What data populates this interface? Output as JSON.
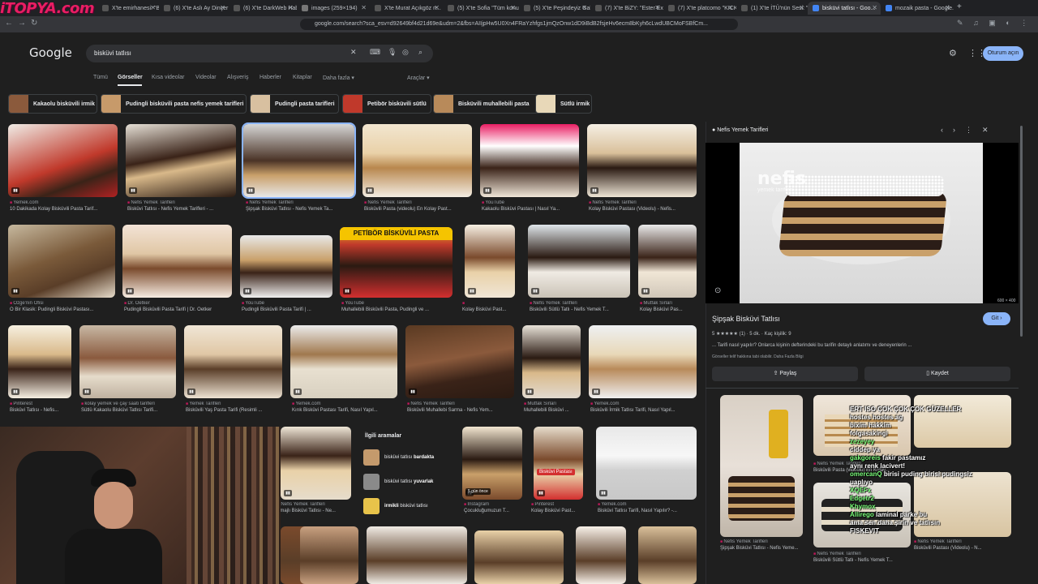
{
  "overlay_logo": "iTOPYA.com",
  "tabs": [
    {
      "label": "X'te emirhanesi: \"Bob..."
    },
    {
      "label": "(6) X'te Aslı Ay Dinçer: \"..."
    },
    {
      "label": "(6) X'te DarkWeb Haber..."
    },
    {
      "label": "images (259×194)"
    },
    {
      "label": "X'te Murat Açıkgöz n..."
    },
    {
      "label": "(5) X'te Sofia \"Tüm konu..."
    },
    {
      "label": "(5) X'te Peşindeyiz Galati..."
    },
    {
      "label": "(7) X'te BiZY: \"Ester Expo"
    },
    {
      "label": "(7) X'te platcomo \"KICK..."
    },
    {
      "label": "(1) X'te İTÜ'nün Sesi: \"K..."
    },
    {
      "label": "bisküvi tatlısı - Goo..."
    },
    {
      "label": "mozaik pasta - Google..."
    }
  ],
  "address": "google.com/search?sca_esv=d92649bf4d21d69e&udm=2&fbs=AIIjpHw5U0Xn4FRaYzhfgs1jmQzOnw1dD9iBdB2fsjeHv6ecm8bKyh6cLwdUBCMoFSBfCm...",
  "google_logo": "Google",
  "search": {
    "query": "bisküvi tatlısı"
  },
  "signin_label": "Oturum açın",
  "nav_tabs": [
    "Tümü",
    "Görseller",
    "Kısa videolar",
    "Videolar",
    "Alışveriş",
    "Haberler",
    "Kitaplar",
    "Daha fazla ▾"
  ],
  "tools_label": "Araçlar ▾",
  "chips": [
    "Kakaolu bisküvili irmik",
    "Pudingli bisküvili pasta nefis yemek tarifleri",
    "Pudingli pasta tarifleri",
    "Petibör bisküvili sütlü",
    "Bisküvili muhallebili pasta",
    "Sütlü irmik"
  ],
  "results": [
    {
      "src": "Yemek.com",
      "title": "10 Dakikada Kolay Bisküvili Pasta Tarif..."
    },
    {
      "src": "Nefis Yemek Tarifleri",
      "title": "Bisküvi Tatlısı - Nefis Yemek Tarifleri - ..."
    },
    {
      "src": "Nefis Yemek Tarifleri",
      "title": "Şipşak Bisküvi Tatlısı - Nefis Yemek Ta..."
    },
    {
      "src": "Nefis Yemek Tarifleri",
      "title": "Bisküvili Pasta (videolu) En Kolay Past..."
    },
    {
      "src": "YouTube",
      "title": "Kakaolu Bisküvi Pastası | Nasıl Ya..."
    },
    {
      "src": "Nefis Yemek Tarifleri",
      "title": "Kolay Bisküvi Pastası (Videolu) - Nefis..."
    },
    {
      "src": "Özge'nin Ofisi",
      "title": "O Bir Klasik: Pudingli Bisküvi Pastası..."
    },
    {
      "src": "Dr. Oetker",
      "title": "Pudingli Bisküvili Pasta Tarifi | Dr. Oetker"
    },
    {
      "src": "YouTube",
      "title": "Pudingli Bisküvili Pasta Tarifi | ..."
    },
    {
      "src": "YouTube",
      "title": "Muhallebili Bisküvili Pasta, Pudingli ve ..."
    },
    {
      "src": "",
      "title": "Kolay Bisküvi Past..."
    },
    {
      "src": "Nefis Yemek Tarifleri",
      "title": "Bisküvili Sütlü Tatlı - Nefis Yemek T..."
    },
    {
      "src": "Mutfak Sırları",
      "title": "Kolay Bisküvi Pas..."
    },
    {
      "src": "Pinterest",
      "title": "Bisküvi Tatlısı - Nefis..."
    },
    {
      "src": "kolay yemek ve çay saati tarifleri",
      "title": "Sütlü Kakaolu Bisküvi Tatlısı Tarifi..."
    },
    {
      "src": "Yemek Tarifleri",
      "title": "Bisküvili Yaş Pasta Tarifi (Resimli ..."
    },
    {
      "src": "Yemek.com",
      "title": "Kırık Bisküvi Pastası Tarifi, Nasıl Yapıl..."
    },
    {
      "src": "Nefis Yemek Tarifleri",
      "title": "Bisküvili Muhallebi Sarma - Nefis Yem..."
    },
    {
      "src": "Mutfak Sırları",
      "title": "Muhallebili Bisküvi ..."
    },
    {
      "src": "Yemek.com",
      "title": "Bisküvili İrmik Tatlısı Tarifi, Nasıl Yapıl..."
    },
    {
      "src": "Nefis Yemek Tarifleri",
      "title": "amajlı Bisküvi Tatlısı - Ne..."
    },
    {
      "src": "Instagram",
      "title": "Çocukluğumuzun T..."
    },
    {
      "src": "Pinterest",
      "title": "Kolay Bisküvi Past..."
    },
    {
      "src": "Yemek.com",
      "title": "Bisküvi Tatlısı Tarifi, Nasıl Yapılır? -..."
    }
  ],
  "badges": {
    "video_ago": "5 gün önce",
    "petibor_banner": "PETİBÖR BİSKÜVİLİ PASTA",
    "biskuvi_pastasi": "Bisküvi Pastası"
  },
  "related": {
    "title": "İlgili aramalar",
    "items": [
      {
        "pre": "bisküvi tatlısı ",
        "bold": "bardakta"
      },
      {
        "pre": "bisküvi tatlısı ",
        "bold": "yuvarlak"
      },
      {
        "pre": "",
        "bold": "irmikli",
        "post": " bisküvi tatlısı"
      }
    ]
  },
  "panel": {
    "source": "Nefis Yemek Tarifleri",
    "watermark": "nefis",
    "watermark_sub": "yemek tarifleri",
    "dims": "600 × 400",
    "title": "Şipşak Bisküvi Tatlısı",
    "go_label": "Git ›",
    "rating": "5 ★★★★★ (1)  ·  5 dk.  ·  Kaç kişilik: 9",
    "description": "... Tarifi nasıl yapılır? Onlarca kişinin defterindeki bu tarifin detaylı anlatımı ve deneyenlerin ...",
    "copyright": "Görseller telif hakkına tabi olabilir. Daha Fazla Bilgi",
    "share_label": "Paylaş",
    "save_label": "Kaydet",
    "related_captions": [
      {
        "src": "Nefis Yemek Tarifleri",
        "title": "Şipşak Bisküvi Tatlısı - Nefis Yeme..."
      },
      {
        "src": "Nefis Yemek Tarifleri",
        "title": "Bisküvili Pasta (videolu) En Kolay..."
      },
      {
        "src": "Nefis Yemek Tarifleri",
        "title": "Bisküvili Sütlü Tatlı - Nefis Yemek T..."
      },
      {
        "src": "Nefis Yemek Tarifleri",
        "title": "Bisküvili Pastası (Videolu) - N..."
      }
    ]
  },
  "chat": [
    {
      "user": "",
      "text": "ERT ISO ÇOK ÇOK ÇOK GÜZELLER"
    },
    {
      "user": "",
      "text": "hostes hostes ag"
    },
    {
      "user": "",
      "text": "bixim hakkim"
    },
    {
      "user": "",
      "text": "folgasakingi"
    },
    {
      "user": "zezeyey",
      "text": ""
    },
    {
      "user": "",
      "text": "ciddep ya"
    },
    {
      "user": "gakgoreis",
      "text": "fakir pastamız"
    },
    {
      "user": "",
      "text": "aynı renk lacivert!"
    },
    {
      "user": "omercanQ",
      "text": "birisi puding birisi pudingsiz"
    },
    {
      "user": "",
      "text": "uaplıyo"
    },
    {
      "user": "XQEFx",
      "text": ""
    },
    {
      "user": "Edgetr2",
      "text": ""
    },
    {
      "user": "Khymox",
      "text": ""
    },
    {
      "user": "Allirego",
      "text": "laminal parke bu"
    },
    {
      "user": "",
      "text": "ama sen daha şirin ve tatlısın"
    },
    {
      "user": "",
      "text": "FISKEVIT"
    }
  ]
}
